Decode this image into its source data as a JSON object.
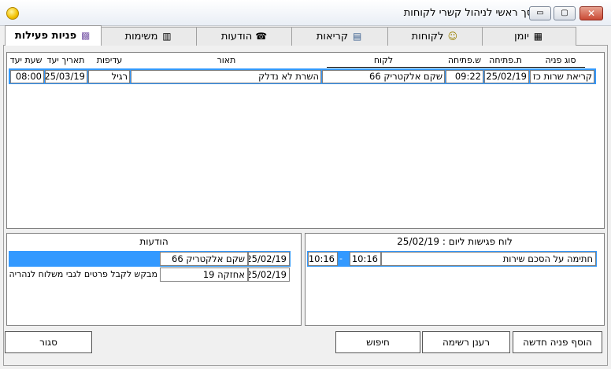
{
  "window": {
    "title": "מסך ראשי לניהול קשרי לקוחות",
    "minimize_glyph": "▭",
    "maximize_glyph": "▢",
    "close_glyph": "✕"
  },
  "tabs": [
    {
      "label": "יומן",
      "icon": "calendar-icon",
      "glyph": "▦"
    },
    {
      "label": "לקוחות",
      "icon": "smiley-icon",
      "glyph": "☺"
    },
    {
      "label": "קריאות",
      "icon": "call-icon",
      "glyph": "▤"
    },
    {
      "label": "הודעות",
      "icon": "phone-icon",
      "glyph": "☎"
    },
    {
      "label": "משימות",
      "icon": "tasks-icon",
      "glyph": "▥"
    },
    {
      "label": "פניות פעילות",
      "icon": "requests-icon",
      "glyph": "▩",
      "active": true
    }
  ],
  "requests_table": {
    "columns": [
      "סוג פניה",
      "ת.פתיחה",
      "ש.פתיחה",
      "לקוח",
      "תאור",
      "עדיפות",
      "תאריך יעד",
      "שעת יעד"
    ],
    "rows": [
      [
        "קריאת שרות כז",
        "25/02/19",
        "09:22",
        "שקם אלקטריק 66",
        "השרת לא נדלק",
        "רגיל",
        "25/03/19",
        "08:00"
      ]
    ]
  },
  "meetings": {
    "title": "לוח פגישות ליום : 25/02/19",
    "rows": [
      {
        "subject": "חתימה על הסכם שירות",
        "from": "10:16",
        "dash": "-",
        "to": "10:16"
      }
    ]
  },
  "messages": {
    "title": "הודעות",
    "rows": [
      {
        "date": "25/02/19",
        "customer": "שקם אלקטריק 66",
        "text": ""
      },
      {
        "date": "25/02/19",
        "customer": "אחזקה 19",
        "text": "מבקש לקבל פרטים לגבי משלוח לנהריה"
      }
    ]
  },
  "buttons": {
    "add": "הוסף פניה חדשה",
    "refresh": "רענן רשימה",
    "search": "חיפוש",
    "close": "סגור"
  }
}
